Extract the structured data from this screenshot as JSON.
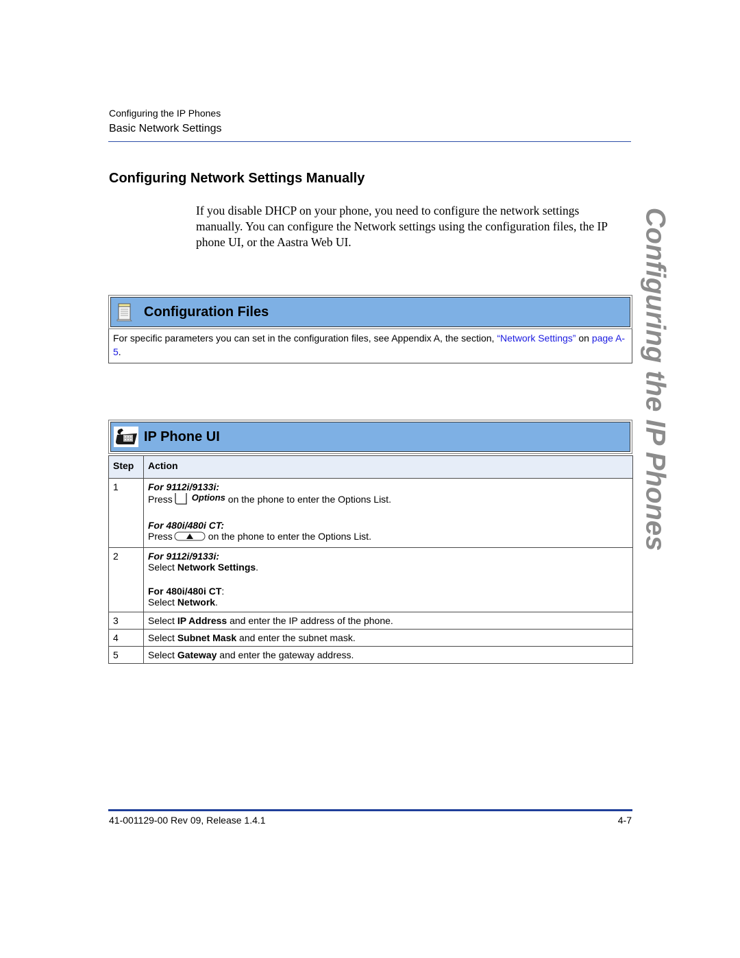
{
  "header": {
    "chapter": "Configuring the IP Phones",
    "section": "Basic Network Settings",
    "rule_color": "#2c4ea8"
  },
  "side_tab": "Configuring the IP Phones",
  "title": "Configuring Network Settings Manually",
  "intro": "If you disable DHCP on your phone, you need to configure the network settings manually. You can configure the Network settings using the configuration files, the IP phone UI, or the Aastra Web UI.",
  "config_files": {
    "title": "Configuration Files",
    "icon": "document-icon",
    "text_before": "For specific parameters you can set in the configuration files, see Appendix A, the section, ",
    "link1": "“Network Settings”",
    "text_middle": " on ",
    "link2": "page A-5",
    "text_after": ".",
    "banner_color": "#7eb0e4",
    "link_color": "#1a1ae0"
  },
  "ip_phone_ui": {
    "title": "IP Phone UI",
    "icon": "phone-icon",
    "columns": [
      "Step",
      "Action"
    ],
    "steps": [
      {
        "num": "1",
        "a_title": "For 9112i/9133i:",
        "a_pre": "Press",
        "a_key": "Options",
        "a_post": "on the phone to enter the Options List.",
        "b_title": "For 480i/480i CT:",
        "b_pre": "Press",
        "b_post": "on the phone to enter the Options List."
      },
      {
        "num": "2",
        "a_title": "For 9112i/9133i:",
        "a_pre": "Select ",
        "a_bold": "Network Settings",
        "a_post": ".",
        "b_title": "For 480i/480i CT",
        "b_title_suffix": ":",
        "b_pre": "Select ",
        "b_bold": "Network",
        "b_post": "."
      },
      {
        "num": "3",
        "pre": "Select ",
        "bold": "IP Address",
        "post": " and enter the IP address of the phone."
      },
      {
        "num": "4",
        "pre": "Select ",
        "bold": "Subnet Mask",
        "post": " and enter the subnet mask."
      },
      {
        "num": "5",
        "pre": "Select ",
        "bold": "Gateway",
        "post": " and enter the gateway address."
      }
    ]
  },
  "footer": {
    "doc_id": "41-001129-00 Rev 09, Release 1.4.1",
    "page": "4-7"
  }
}
